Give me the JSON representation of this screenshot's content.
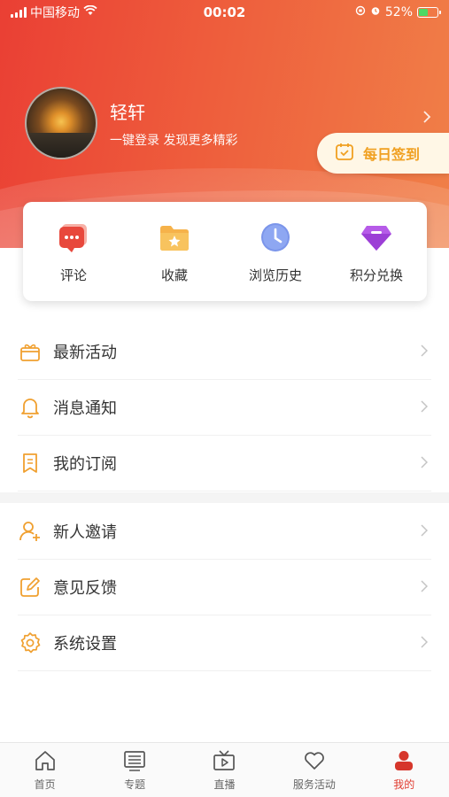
{
  "status_bar": {
    "carrier": "中国移动",
    "time": "00:02",
    "battery_percent": "52%",
    "battery_level": 0.52
  },
  "profile": {
    "username": "轻轩",
    "tagline": "一键登录  发现更多精彩"
  },
  "checkin": {
    "label": "每日签到"
  },
  "quick_actions": [
    {
      "label": "评论",
      "icon": "comment-icon"
    },
    {
      "label": "收藏",
      "icon": "favorites-folder-icon"
    },
    {
      "label": "浏览历史",
      "icon": "clock-icon"
    },
    {
      "label": "积分兑换",
      "icon": "gem-icon"
    }
  ],
  "menu_group_1": [
    {
      "label": "最新活动",
      "icon": "gift-icon"
    },
    {
      "label": "消息通知",
      "icon": "bell-icon"
    },
    {
      "label": "我的订阅",
      "icon": "bookmark-icon"
    }
  ],
  "menu_group_2": [
    {
      "label": "新人邀请",
      "icon": "add-user-icon"
    },
    {
      "label": "意见反馈",
      "icon": "edit-icon"
    },
    {
      "label": "系统设置",
      "icon": "gear-icon"
    }
  ],
  "tabbar": [
    {
      "label": "首页",
      "icon": "home-icon"
    },
    {
      "label": "专题",
      "icon": "topics-icon"
    },
    {
      "label": "直播",
      "icon": "live-tv-icon"
    },
    {
      "label": "服务活动",
      "icon": "heart-icon"
    },
    {
      "label": "我的",
      "icon": "profile-icon",
      "active": true
    }
  ],
  "colors": {
    "brand_red": "#e03a2e",
    "accent_orange": "#f0a021",
    "menu_icon_orange": "#f0a030"
  }
}
